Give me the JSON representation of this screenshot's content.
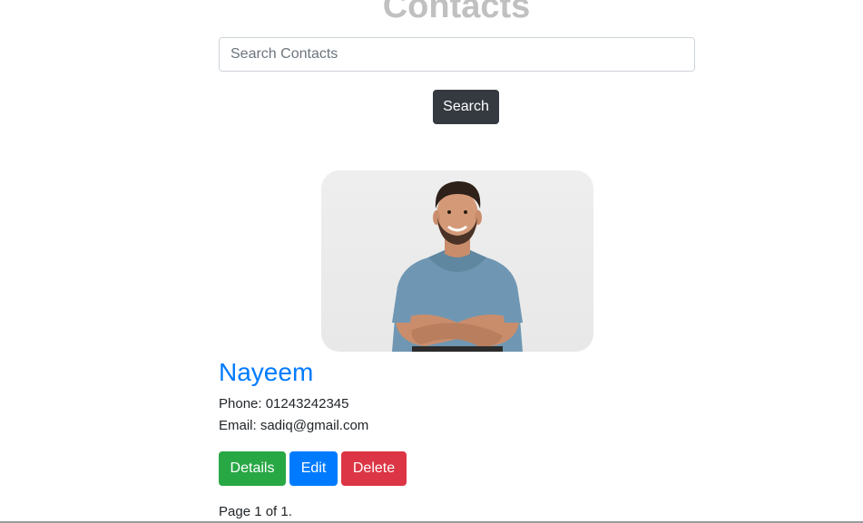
{
  "header": {
    "title": "Contacts"
  },
  "search": {
    "placeholder": "Search Contacts",
    "value": "",
    "button_label": "Search"
  },
  "contact": {
    "photo_icon": "person-photo",
    "name": "Nayeem",
    "phone_line": "Phone: 01243242345",
    "email_line": "Email: sadiq@gmail.com",
    "actions": {
      "details_label": "Details",
      "edit_label": "Edit",
      "delete_label": "Delete"
    }
  },
  "pagination": {
    "text": "Page 1 of 1."
  },
  "colors": {
    "title": "#c0c0c0",
    "search_button": "#343a40",
    "name_link": "#007bff",
    "details": "#28a745",
    "edit": "#007bff",
    "delete": "#dc3545"
  }
}
